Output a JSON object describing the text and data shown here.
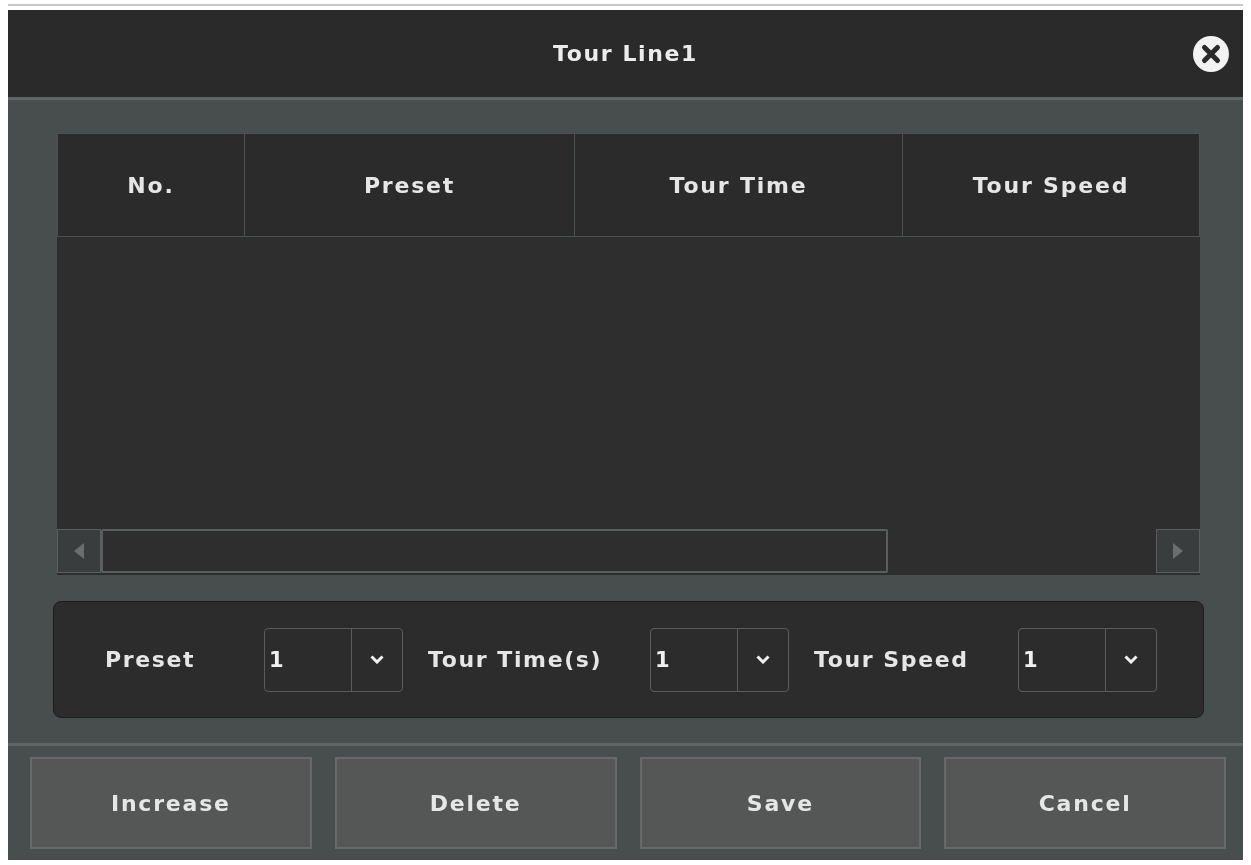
{
  "window": {
    "title": "Tour Line1"
  },
  "table": {
    "columns": [
      "No.",
      "Preset",
      "Tour Time",
      "Tour Speed"
    ]
  },
  "fields": [
    {
      "label": "Preset",
      "value": "1"
    },
    {
      "label": "Tour Time(s)",
      "value": "1"
    },
    {
      "label": "Tour Speed",
      "value": "1"
    }
  ],
  "buttons": [
    "Increase",
    "Delete",
    "Save",
    "Cancel"
  ]
}
